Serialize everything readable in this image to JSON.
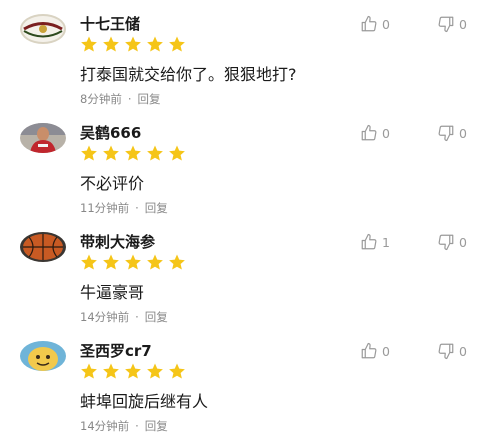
{
  "colors": {
    "star": "#f5c518",
    "username": "#1a1a1a",
    "meta": "#888888",
    "vote": "#9a9a9a"
  },
  "icons": {
    "like": "thumbs-up-icon",
    "dislike": "thumbs-down-icon",
    "star": "star-icon"
  },
  "comments": [
    {
      "username": "十七王储",
      "stars": 5,
      "text": "打泰国就交给你了。狠狠地打?",
      "time": "8分钟前",
      "reply": "回复",
      "likes": "0",
      "dislikes": "0",
      "avatar": "soccer-ball-avatar"
    },
    {
      "username": "吴鹤666",
      "stars": 5,
      "text": "不必评价",
      "time": "11分钟前",
      "reply": "回复",
      "likes": "0",
      "dislikes": "0",
      "avatar": "player-photo-avatar"
    },
    {
      "username": "带刺大海参",
      "stars": 5,
      "text": "牛逼豪哥",
      "time": "14分钟前",
      "reply": "回复",
      "likes": "1",
      "dislikes": "0",
      "avatar": "basketball-avatar"
    },
    {
      "username": "圣西罗cr7",
      "stars": 5,
      "text": "蚌埠回旋后继有人",
      "time": "14分钟前",
      "reply": "回复",
      "likes": "0",
      "dislikes": "0",
      "avatar": "cartoon-avatar"
    }
  ]
}
